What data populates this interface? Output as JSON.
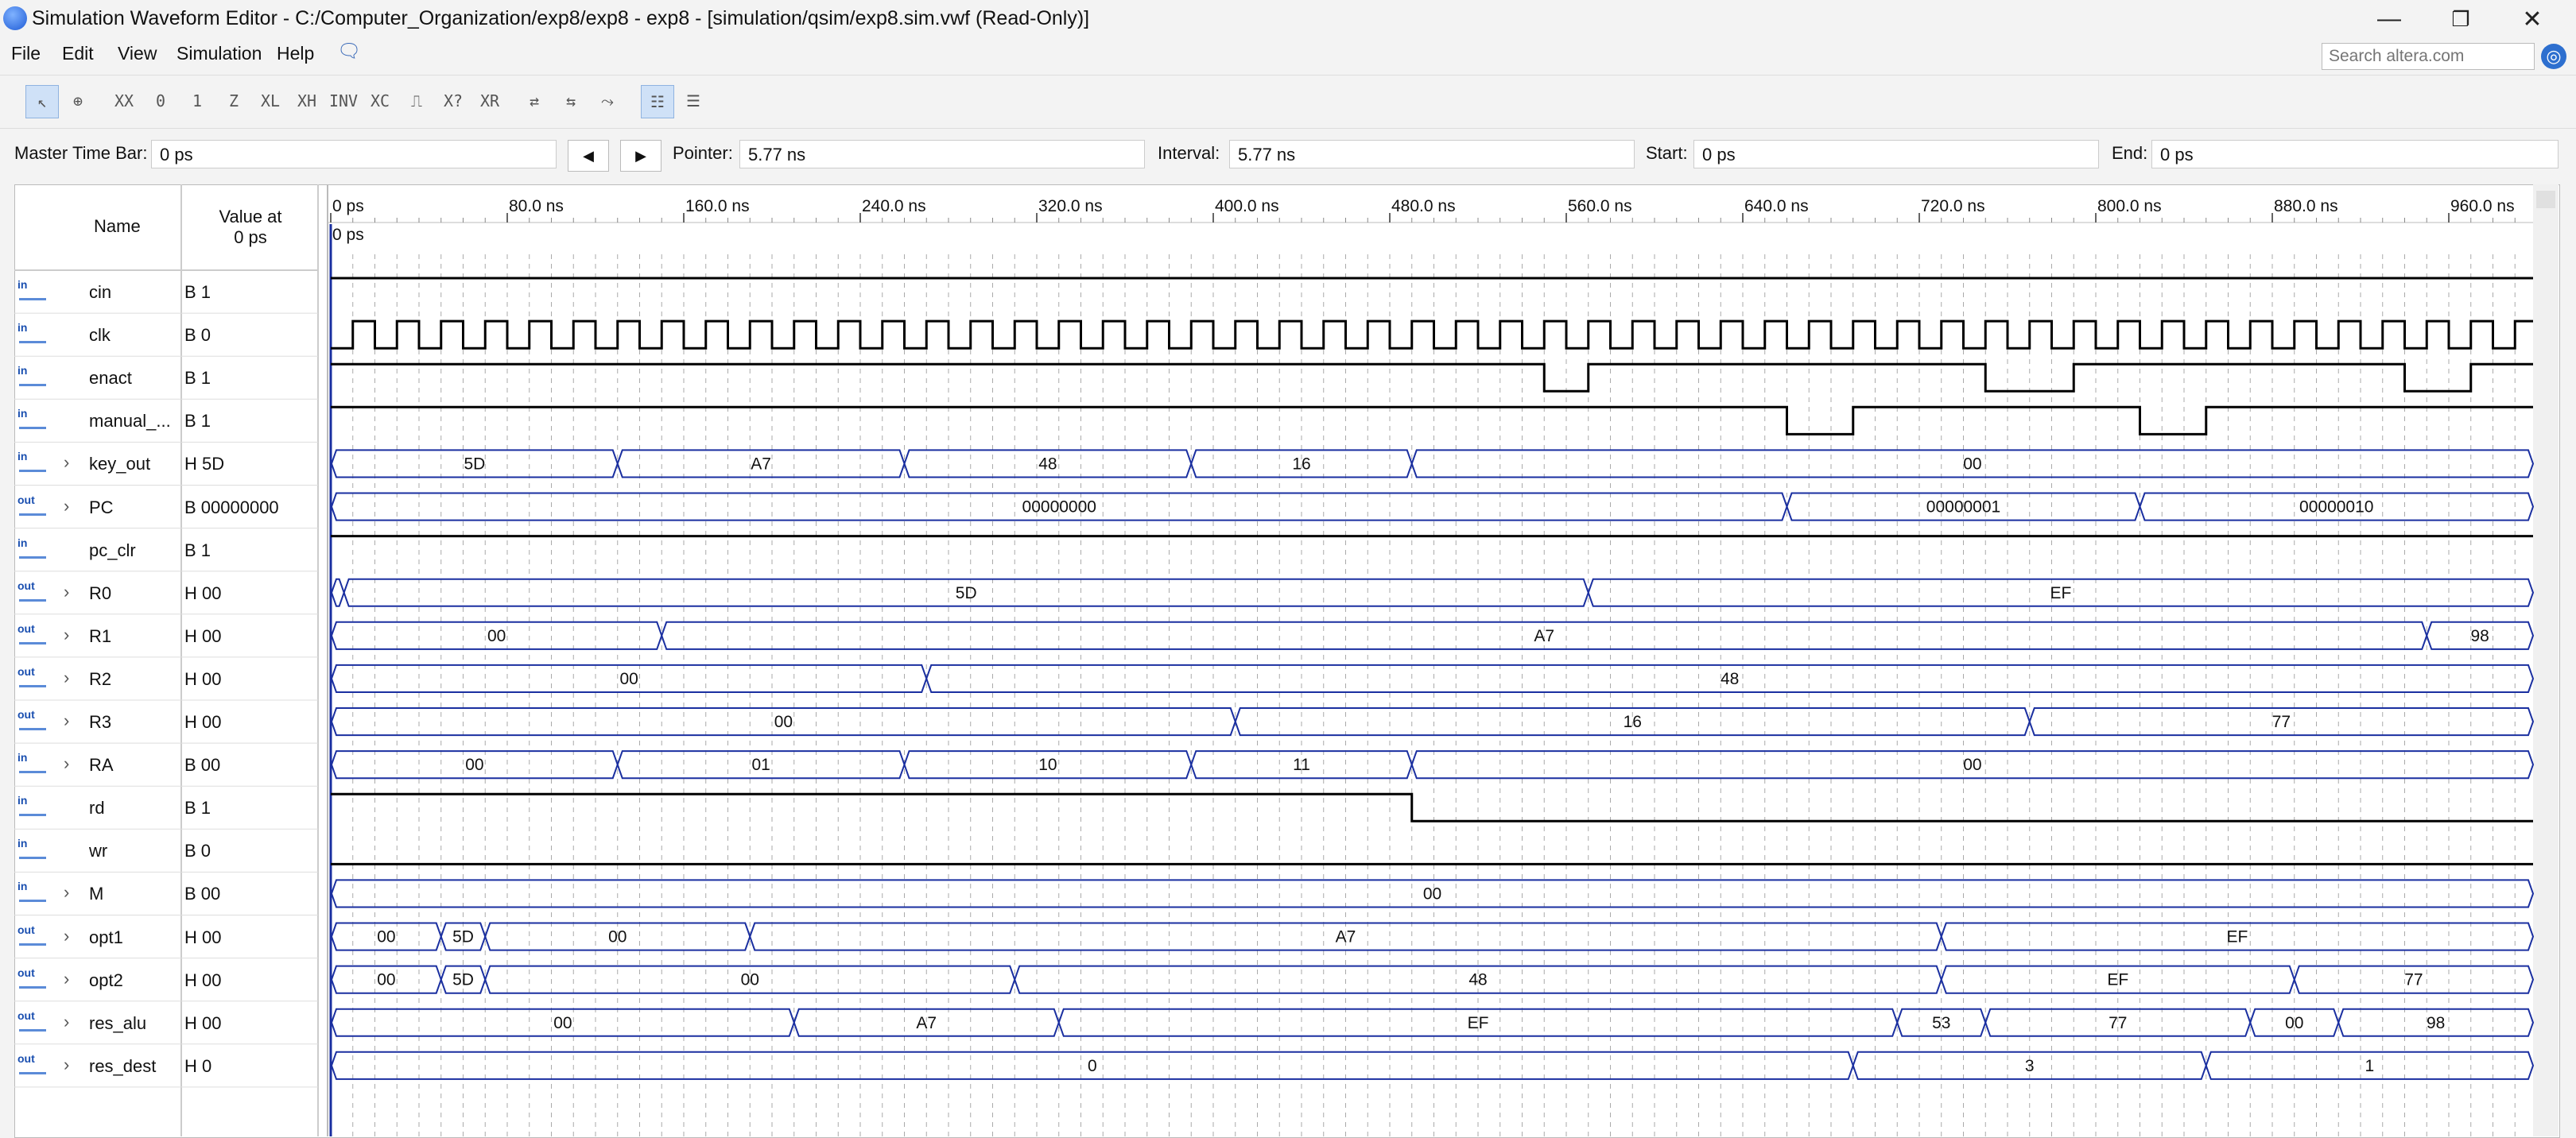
{
  "window": {
    "title": "Simulation Waveform Editor - C:/Computer_Organization/exp8/exp8 - exp8 - [simulation/qsim/exp8.sim.vwf (Read-Only)]",
    "controls": [
      "minimize-icon",
      "restore-icon",
      "close-icon"
    ]
  },
  "menu": [
    "File",
    "Edit",
    "View",
    "Simulation",
    "Help"
  ],
  "search": {
    "placeholder": "Search altera.com"
  },
  "toolbar_icons": [
    "selection-tool-icon",
    "zoom-tool-icon",
    "weak-unknown-icon",
    "forcing-low-icon",
    "forcing-high-icon",
    "high-impedance-icon",
    "weak-low-icon",
    "weak-high-icon",
    "invert-icon",
    "count-value-icon",
    "clock-icon",
    "random-value-icon",
    "dont-care-icon",
    "overwrite-icon",
    "snap-to-grid-icon",
    "group-icon",
    "ungroup-icon",
    "grid-view-icon",
    "waveform-view-icon"
  ],
  "timebar": {
    "master_label": "Master Time Bar:",
    "master_value": "0 ps",
    "pointer_label": "Pointer:",
    "pointer_value": "5.77 ns",
    "interval_label": "Interval:",
    "interval_value": "5.77 ns",
    "start_label": "Start:",
    "start_value": "0 ps",
    "end_label": "End:",
    "end_value": "0 ps"
  },
  "columns": {
    "name": "Name",
    "value_line1": "Value at",
    "value_line2": "0 ps"
  },
  "time_ruler": [
    "0 ps",
    "80.0 ns",
    "160.0 ns",
    "240.0 ns",
    "320.0 ns",
    "400.0 ns",
    "480.0 ns",
    "560.0 ns",
    "640.0 ns",
    "720.0 ns",
    "800.0 ns",
    "880.0 ns",
    "960.0 ns"
  ],
  "cursor_label": "0 ps",
  "time_range_ns": [
    0,
    1000
  ],
  "signals": [
    {
      "dir": "in",
      "name": "cin",
      "value": "B 1",
      "bus": false
    },
    {
      "dir": "in",
      "name": "clk",
      "value": "B 0",
      "bus": false
    },
    {
      "dir": "in",
      "name": "enact",
      "value": "B 1",
      "bus": false
    },
    {
      "dir": "in",
      "name": "manual_...",
      "value": "B 1",
      "bus": false
    },
    {
      "dir": "in",
      "name": "key_out",
      "value": "H 5D",
      "bus": true
    },
    {
      "dir": "out",
      "name": "PC",
      "value": "B 00000000",
      "bus": true
    },
    {
      "dir": "in",
      "name": "pc_clr",
      "value": "B 1",
      "bus": false
    },
    {
      "dir": "out",
      "name": "R0",
      "value": "H 00",
      "bus": true
    },
    {
      "dir": "out",
      "name": "R1",
      "value": "H 00",
      "bus": true
    },
    {
      "dir": "out",
      "name": "R2",
      "value": "H 00",
      "bus": true
    },
    {
      "dir": "out",
      "name": "R3",
      "value": "H 00",
      "bus": true
    },
    {
      "dir": "in",
      "name": "RA",
      "value": "B 00",
      "bus": true
    },
    {
      "dir": "in",
      "name": "rd",
      "value": "B 1",
      "bus": false
    },
    {
      "dir": "in",
      "name": "wr",
      "value": "B 0",
      "bus": false
    },
    {
      "dir": "in",
      "name": "M",
      "value": "B 00",
      "bus": true
    },
    {
      "dir": "out",
      "name": "opt1",
      "value": "H 00",
      "bus": true
    },
    {
      "dir": "out",
      "name": "opt2",
      "value": "H 00",
      "bus": true
    },
    {
      "dir": "out",
      "name": "res_alu",
      "value": "H 00",
      "bus": true
    },
    {
      "dir": "out",
      "name": "res_dest",
      "value": "H 0",
      "bus": true
    }
  ],
  "waveforms": {
    "cin": {
      "kind": "level",
      "segments": [
        [
          0,
          1000,
          1
        ]
      ]
    },
    "clk": {
      "kind": "clock",
      "period_ns": 20,
      "start_level": 0
    },
    "enact": {
      "kind": "level",
      "segments": [
        [
          0,
          550,
          1
        ],
        [
          550,
          570,
          0
        ],
        [
          570,
          750,
          1
        ],
        [
          750,
          790,
          0
        ],
        [
          790,
          940,
          1
        ],
        [
          940,
          970,
          0
        ],
        [
          970,
          1000,
          1
        ]
      ]
    },
    "manual_...": {
      "kind": "level",
      "segments": [
        [
          0,
          660,
          1
        ],
        [
          660,
          690,
          0
        ],
        [
          690,
          820,
          1
        ],
        [
          820,
          850,
          0
        ],
        [
          850,
          1000,
          1
        ]
      ]
    },
    "key_out": {
      "kind": "bus",
      "segments": [
        [
          0,
          130,
          "5D"
        ],
        [
          130,
          260,
          "A7"
        ],
        [
          260,
          390,
          "48"
        ],
        [
          390,
          490,
          "16"
        ],
        [
          490,
          1000,
          "00"
        ]
      ]
    },
    "PC": {
      "kind": "bus",
      "segments": [
        [
          0,
          660,
          "00000000"
        ],
        [
          660,
          820,
          "00000001"
        ],
        [
          820,
          1000,
          "00000010"
        ]
      ]
    },
    "pc_clr": {
      "kind": "level",
      "segments": [
        [
          0,
          1000,
          1
        ]
      ]
    },
    "R0": {
      "kind": "bus",
      "segments": [
        [
          0,
          6,
          ""
        ],
        [
          6,
          570,
          "5D"
        ],
        [
          570,
          1000,
          "EF"
        ]
      ]
    },
    "R1": {
      "kind": "bus",
      "segments": [
        [
          0,
          150,
          "00"
        ],
        [
          150,
          950,
          "A7"
        ],
        [
          950,
          1000,
          "98"
        ]
      ]
    },
    "R2": {
      "kind": "bus",
      "segments": [
        [
          0,
          270,
          "00"
        ],
        [
          270,
          1000,
          "48"
        ]
      ]
    },
    "R3": {
      "kind": "bus",
      "segments": [
        [
          0,
          410,
          "00"
        ],
        [
          410,
          770,
          "16"
        ],
        [
          770,
          1000,
          "77"
        ]
      ]
    },
    "RA": {
      "kind": "bus",
      "segments": [
        [
          0,
          130,
          "00"
        ],
        [
          130,
          260,
          "01"
        ],
        [
          260,
          390,
          "10"
        ],
        [
          390,
          490,
          "11"
        ],
        [
          490,
          1000,
          "00"
        ]
      ]
    },
    "rd": {
      "kind": "level",
      "segments": [
        [
          0,
          490,
          1
        ],
        [
          490,
          1000,
          0
        ]
      ]
    },
    "wr": {
      "kind": "level",
      "segments": [
        [
          0,
          1000,
          0
        ]
      ]
    },
    "M": {
      "kind": "bus",
      "segments": [
        [
          0,
          1000,
          "00"
        ]
      ]
    },
    "opt1": {
      "kind": "bus",
      "segments": [
        [
          0,
          50,
          "00"
        ],
        [
          50,
          70,
          "5D"
        ],
        [
          70,
          190,
          "00"
        ],
        [
          190,
          730,
          "A7"
        ],
        [
          730,
          1000,
          "EF"
        ]
      ]
    },
    "opt2": {
      "kind": "bus",
      "segments": [
        [
          0,
          50,
          "00"
        ],
        [
          50,
          70,
          "5D"
        ],
        [
          70,
          310,
          "00"
        ],
        [
          310,
          730,
          "48"
        ],
        [
          730,
          890,
          "EF"
        ],
        [
          890,
          1000,
          "77"
        ]
      ]
    },
    "res_alu": {
      "kind": "bus",
      "segments": [
        [
          0,
          210,
          "00"
        ],
        [
          210,
          330,
          "A7"
        ],
        [
          330,
          710,
          "EF"
        ],
        [
          710,
          750,
          "53"
        ],
        [
          750,
          870,
          "77"
        ],
        [
          870,
          910,
          "00"
        ],
        [
          910,
          1000,
          "98"
        ]
      ]
    },
    "res_dest": {
      "kind": "bus",
      "segments": [
        [
          0,
          690,
          "0"
        ],
        [
          690,
          850,
          "3"
        ],
        [
          850,
          1000,
          "1"
        ]
      ]
    }
  },
  "colors": {
    "bus": "#1a2fa0",
    "level": "#000000",
    "grid": "#aaaaaa",
    "cursor": "#1a2fa0"
  }
}
